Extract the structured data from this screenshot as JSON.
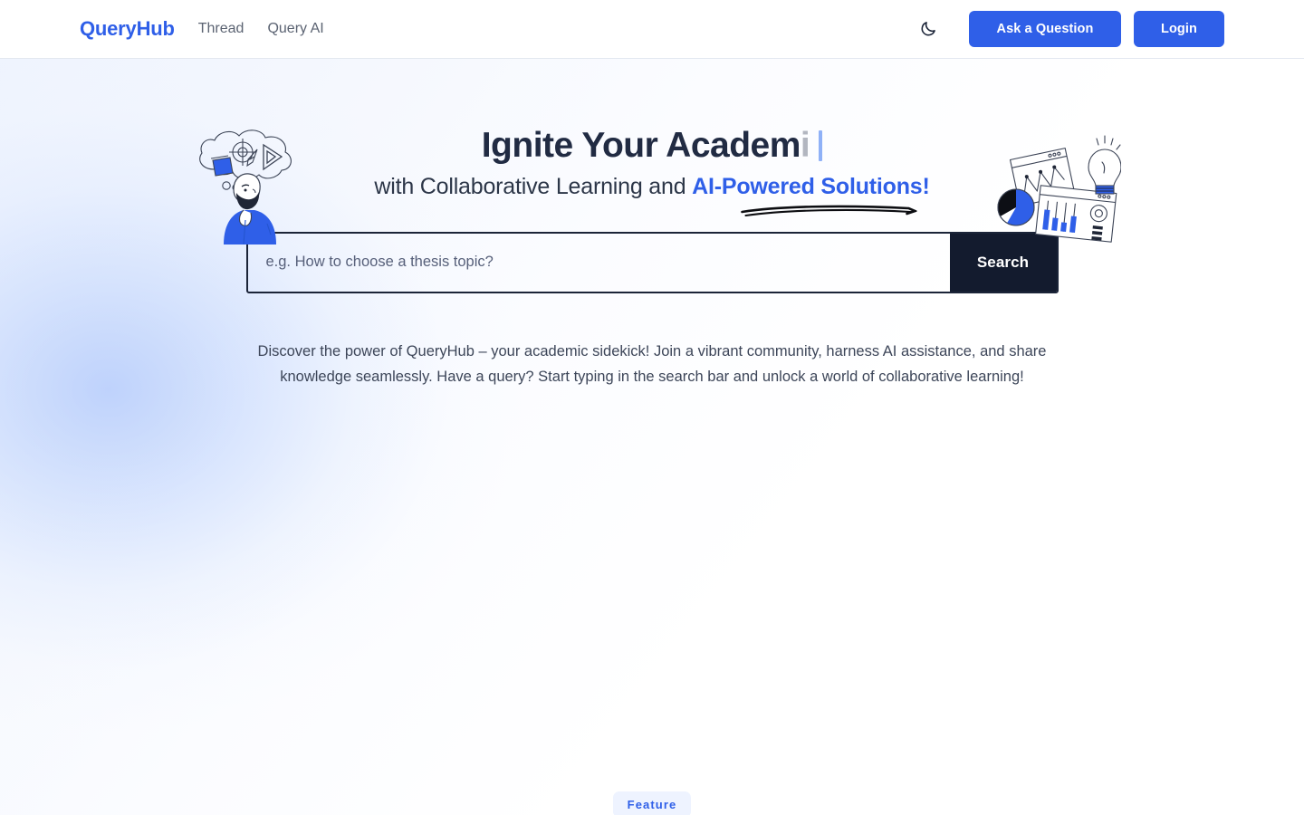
{
  "brand": {
    "name": "QueryHub"
  },
  "nav": {
    "links": [
      {
        "label": "Thread"
      },
      {
        "label": "Query AI"
      }
    ],
    "theme_toggle_icon": "moon-icon",
    "ask_button": "Ask a Question",
    "login_button": "Login"
  },
  "hero": {
    "headline_static": "Ignite Your Academ",
    "headline_typing": "i",
    "subheadline_prefix": "with Collaborative Learning and ",
    "subheadline_accent": "AI-Powered Solutions!",
    "description": "Discover the power of QueryHub – your academic sidekick! Join a vibrant community, harness AI assistance, and share knowledge seamlessly. Have a query? Start typing in the search bar and unlock a world of collaborative learning!",
    "illustration_left": "thinking-person-illustration",
    "illustration_right": "data-analytics-illustration",
    "underline": "hand-drawn-underline"
  },
  "search": {
    "placeholder": "e.g. How to choose a thesis topic?",
    "value": "",
    "button_label": "Search"
  },
  "feature": {
    "badge_label": "Feature"
  },
  "colors": {
    "accent_blue": "#2f5fe8",
    "dark_navy": "#131b2e",
    "heading": "#212b43",
    "badge_bg": "#eef3ff",
    "caret": "#8fb1f7"
  }
}
